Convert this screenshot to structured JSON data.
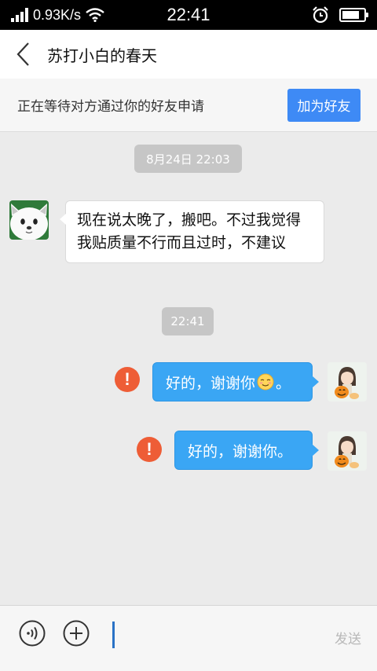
{
  "status_bar": {
    "speed": "0.93K/s",
    "time": "22:41",
    "icons": [
      "signal-icon",
      "wifi-icon",
      "alarm-icon",
      "battery-icon"
    ]
  },
  "header": {
    "title": "苏打小白的春天",
    "back_icon": "chevron-left-icon"
  },
  "friend_request": {
    "text": "正在等待对方通过你的好友申请",
    "button_label": "加为好友"
  },
  "messages": [
    {
      "type": "timestamp",
      "text": "8月24日 22:03"
    },
    {
      "type": "incoming",
      "text": "现在说太晚了，搬吧。不过我觉得我贴质量不行而且过时，不建议"
    },
    {
      "type": "timestamp",
      "text": "22:41"
    },
    {
      "type": "outgoing",
      "text_before": "好的，谢谢你",
      "emoji": "smiling-blush-emoji",
      "text_after": "。",
      "status": "failed"
    },
    {
      "type": "outgoing",
      "text": "好的，谢谢你。",
      "status": "failed"
    }
  ],
  "input_bar": {
    "voice_icon": "voice-icon",
    "plus_icon": "plus-icon",
    "send_label": "发送"
  },
  "colors": {
    "accent": "#3e8af5",
    "outgoing_bubble": "#3aa6f4",
    "error": "#ee5d36",
    "timestamp_bg": "#c6c6c6"
  }
}
